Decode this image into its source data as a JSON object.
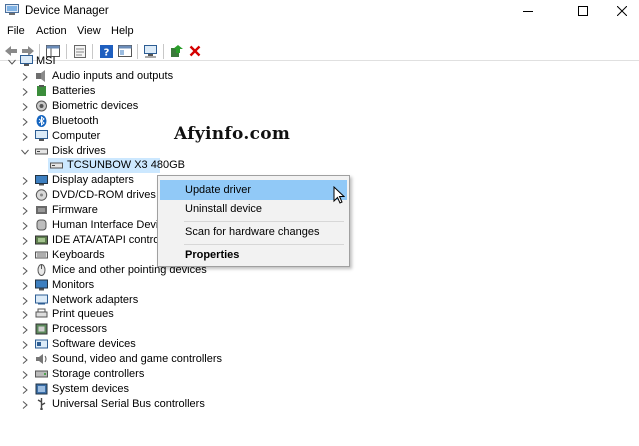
{
  "window": {
    "title": "Device Manager"
  },
  "menu": [
    "File",
    "Action",
    "View",
    "Help"
  ],
  "tree": {
    "root": "MSI",
    "categories": [
      "Audio inputs and outputs",
      "Batteries",
      "Biometric devices",
      "Bluetooth",
      "Computer",
      "Disk drives",
      "Display adapters",
      "DVD/CD-ROM drives",
      "Firmware",
      "Human Interface Device",
      "IDE ATA/ATAPI controlle",
      "Keyboards",
      "Mice and other pointing devices",
      "Monitors",
      "Network adapters",
      "Print queues",
      "Processors",
      "Software devices",
      "Sound, video and game controllers",
      "Storage controllers",
      "System devices",
      "Universal Serial Bus controllers"
    ],
    "selected_device": "TCSUNBOW X3 480GB"
  },
  "watermark": "Afyinfo.com",
  "context_menu": {
    "update": "Update driver",
    "uninstall": "Uninstall device",
    "scan": "Scan for hardware changes",
    "properties": "Properties"
  },
  "colors": {
    "selection": "#cce8ff",
    "menu_hover": "#91c9f7",
    "remove_red": "#d40000",
    "help_blue": "#1f5fbf"
  }
}
